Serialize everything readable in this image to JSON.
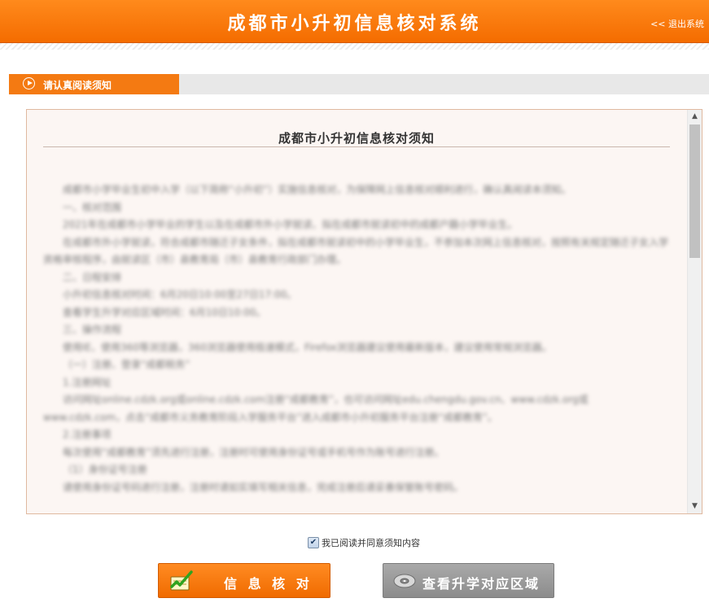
{
  "header": {
    "title": "成都市小升初信息核对系统",
    "logout_label": "<< 退出系统"
  },
  "section": {
    "tab_label": "请认真阅读须知",
    "icon": "play-circle-icon"
  },
  "notice": {
    "title": "成都市小升初信息核对须知",
    "paragraphs": [
      "成都市小学毕业生初中入学（以下简称“小升初”）实施信息核对，为保障网上信息核对顺利进行，确认真阅读本须知。",
      "一、核对范围",
      "2021年在成都市小学毕业的学生以及在成都市外小学就读、拟在成都市就读初中的成都户籍小学毕业生。",
      "在成都市外小学就读，符合成都市随迁子女条件，拟在成都市就读初中的小学毕业生，不参加本次网上信息核对，按照有关规定随迁子女入学资格审核程序，由就读区（市）县教育局（市）县教育行政部门办理。",
      "二、日程安排",
      "小升初信息核对时间：6月20日10:00至27日17:00。",
      "查看学生升学对应区域时间：6月10日10:00。",
      "三、操作流程",
      "使用IE、使用360等浏览器，360浏览器使用极速模式，Firefox浏览器建议使用最新版本，建议使用常规浏览器。",
      "（一）注册、登录“成都税务”",
      "1.注册网址",
      "访问网址online.cdzk.org或online.cdzk.com注册“成都教育”，也可访问网址edu.chengdu.gov.cn、www.cdzk.org或www.cdzk.com，点击“成都市义务教育阶段入学服务平台”进入成都市小升初服务平台注册“成都教育”。",
      "2.注册事项",
      "每次使用“成都教育”须先进行注册，注册时可使用身份证号或手机号作为账号进行注册。",
      "（1）身份证号注册",
      "请使用身份证号码进行注册，注册时请如实填写相关信息，完成注册后请妥善保管账号密码。"
    ]
  },
  "agree": {
    "checked": true,
    "label": "我已阅读并同意须知内容"
  },
  "buttons": {
    "verify_label": "信 息 核 对",
    "verify_icon": "pencil-notepad-icon",
    "region_label": "查看升学对应区域",
    "region_icon": "disc-icon"
  },
  "colors": {
    "brand_orange": "#f47a12",
    "button_gray": "#9a9a9a",
    "notice_bg": "#fcf6f3"
  }
}
